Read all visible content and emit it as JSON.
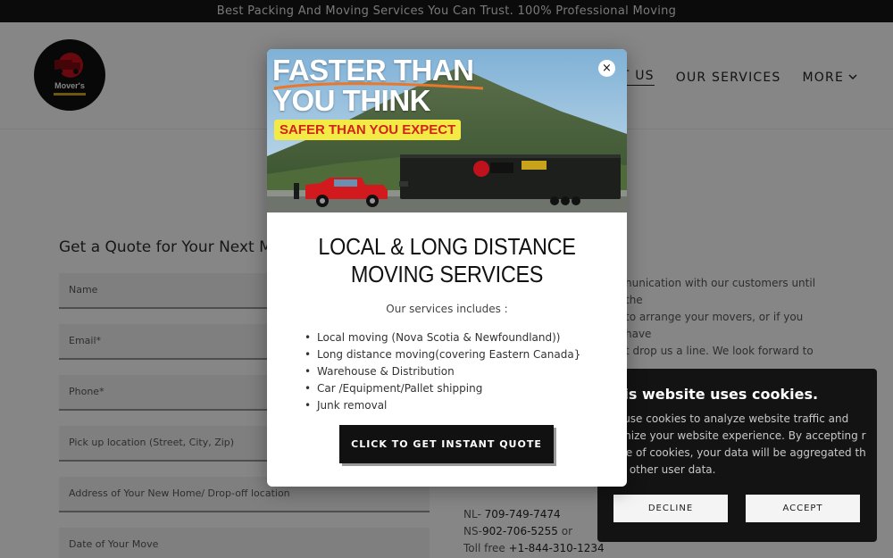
{
  "topbar": {
    "text": "Best Packing And Moving Services You Can Trust. 100% Professional Moving"
  },
  "header": {
    "logo_text": "Mover's",
    "nav": [
      {
        "label": "ACT US"
      },
      {
        "label": "OUR SERVICES"
      },
      {
        "label": "MORE"
      }
    ]
  },
  "form": {
    "title": "Get a Quote for Your Next Mo",
    "fields": [
      {
        "placeholder": "Name"
      },
      {
        "placeholder": "Email*"
      },
      {
        "placeholder": "Phone*"
      },
      {
        "placeholder": "Pick up location (Street, City, Zip)"
      },
      {
        "placeholder": "Address of Your New Home/ Drop-off location"
      },
      {
        "placeholder": "Date of Your Move"
      }
    ]
  },
  "about": {
    "lines": [
      "nunication with our customers until the",
      "to arrange your movers, or if you have",
      "t drop us a line. We look forward to"
    ]
  },
  "contact": {
    "nl_label": "NL- ",
    "nl_phone": "709-749-7474",
    "ns_label": "NS-",
    "ns_phone": "902-706-5255",
    "ns_suffix": " or",
    "toll_label": "Toll free ",
    "toll_phone": "+1-844-310-1234"
  },
  "cookie": {
    "title": "his website uses cookies.",
    "body": "e use cookies to analyze website traffic and timize your website experience. By accepting r use of cookies, your data will be aggregated th all other user data.",
    "decline": "DECLINE",
    "accept": "ACCEPT"
  },
  "modal": {
    "hero_line1": "FASTER THAN",
    "hero_line2": "YOU THINK",
    "hero_badge": "SAFER THAN YOU EXPECT",
    "close": "×",
    "title": "LOCAL & LONG DISTANCE MOVING SERVICES",
    "subtitle": "Our services includes :",
    "services": [
      "Local moving (Nova Scotia & Newfoundland))",
      "Long distance moving(covering Eastern Canada}",
      "Warehouse & Distribution",
      "Car /Equipment/Pallet shipping",
      "Junk removal"
    ],
    "cta": "CLICK TO GET INSTANT QUOTE"
  }
}
